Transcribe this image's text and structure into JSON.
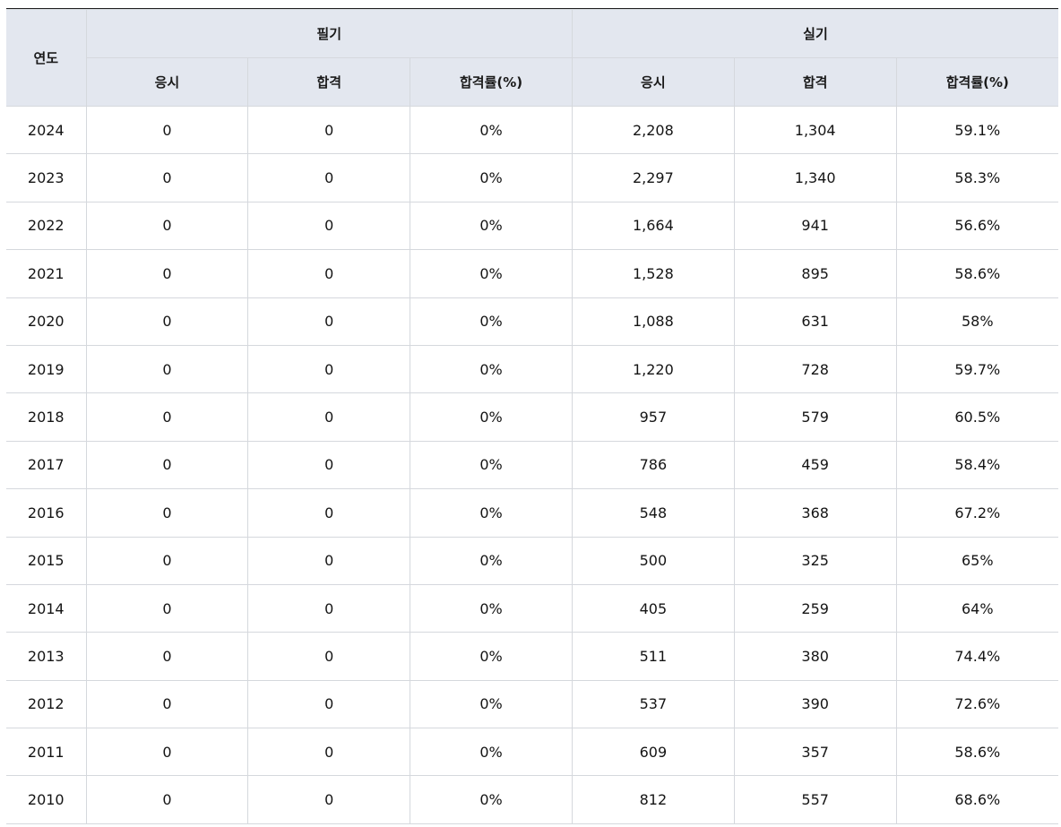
{
  "table": {
    "header": {
      "year": "연도",
      "written": "필기",
      "practical": "실기",
      "applicants": "응시",
      "passed": "합격",
      "pass_rate": "합격률(%)"
    },
    "rows": [
      {
        "year": "2024",
        "w_app": "0",
        "w_pass": "0",
        "w_rate": "0%",
        "p_app": "2,208",
        "p_pass": "1,304",
        "p_rate": "59.1%"
      },
      {
        "year": "2023",
        "w_app": "0",
        "w_pass": "0",
        "w_rate": "0%",
        "p_app": "2,297",
        "p_pass": "1,340",
        "p_rate": "58.3%"
      },
      {
        "year": "2022",
        "w_app": "0",
        "w_pass": "0",
        "w_rate": "0%",
        "p_app": "1,664",
        "p_pass": "941",
        "p_rate": "56.6%"
      },
      {
        "year": "2021",
        "w_app": "0",
        "w_pass": "0",
        "w_rate": "0%",
        "p_app": "1,528",
        "p_pass": "895",
        "p_rate": "58.6%"
      },
      {
        "year": "2020",
        "w_app": "0",
        "w_pass": "0",
        "w_rate": "0%",
        "p_app": "1,088",
        "p_pass": "631",
        "p_rate": "58%"
      },
      {
        "year": "2019",
        "w_app": "0",
        "w_pass": "0",
        "w_rate": "0%",
        "p_app": "1,220",
        "p_pass": "728",
        "p_rate": "59.7%"
      },
      {
        "year": "2018",
        "w_app": "0",
        "w_pass": "0",
        "w_rate": "0%",
        "p_app": "957",
        "p_pass": "579",
        "p_rate": "60.5%"
      },
      {
        "year": "2017",
        "w_app": "0",
        "w_pass": "0",
        "w_rate": "0%",
        "p_app": "786",
        "p_pass": "459",
        "p_rate": "58.4%"
      },
      {
        "year": "2016",
        "w_app": "0",
        "w_pass": "0",
        "w_rate": "0%",
        "p_app": "548",
        "p_pass": "368",
        "p_rate": "67.2%"
      },
      {
        "year": "2015",
        "w_app": "0",
        "w_pass": "0",
        "w_rate": "0%",
        "p_app": "500",
        "p_pass": "325",
        "p_rate": "65%"
      },
      {
        "year": "2014",
        "w_app": "0",
        "w_pass": "0",
        "w_rate": "0%",
        "p_app": "405",
        "p_pass": "259",
        "p_rate": "64%"
      },
      {
        "year": "2013",
        "w_app": "0",
        "w_pass": "0",
        "w_rate": "0%",
        "p_app": "511",
        "p_pass": "380",
        "p_rate": "74.4%"
      },
      {
        "year": "2012",
        "w_app": "0",
        "w_pass": "0",
        "w_rate": "0%",
        "p_app": "537",
        "p_pass": "390",
        "p_rate": "72.6%"
      },
      {
        "year": "2011",
        "w_app": "0",
        "w_pass": "0",
        "w_rate": "0%",
        "p_app": "609",
        "p_pass": "357",
        "p_rate": "58.6%"
      },
      {
        "year": "2010",
        "w_app": "0",
        "w_pass": "0",
        "w_rate": "0%",
        "p_app": "812",
        "p_pass": "557",
        "p_rate": "68.6%"
      }
    ]
  }
}
